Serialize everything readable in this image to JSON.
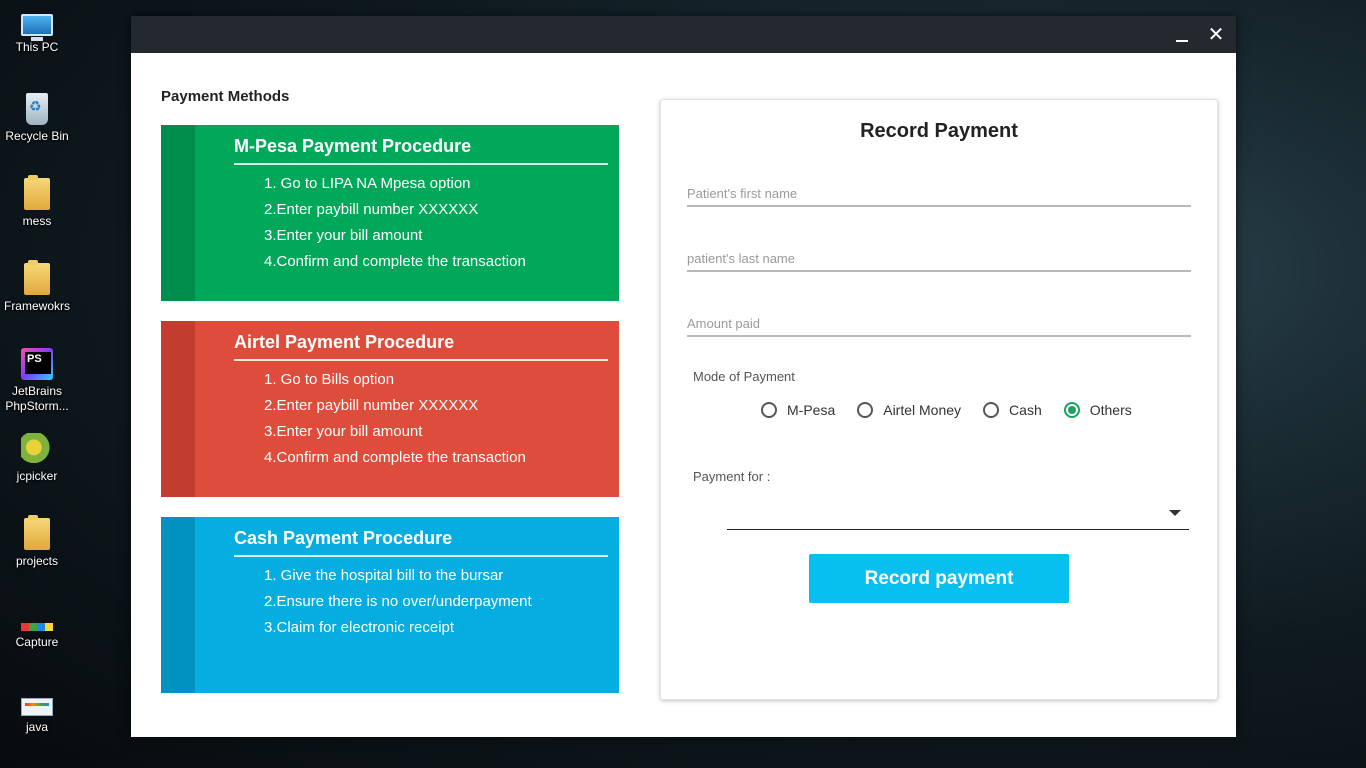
{
  "desktop": {
    "icons": [
      {
        "label": "This PC",
        "icon": "computer-icon"
      },
      {
        "label": "Recycle Bin",
        "icon": "recycle-bin-icon"
      },
      {
        "label": "mess",
        "icon": "folder-icon"
      },
      {
        "label": "Framewokrs",
        "icon": "folder-icon"
      },
      {
        "label": "JetBrains PhpStorm...",
        "icon": "phpstorm-icon"
      },
      {
        "label": "jcpicker",
        "icon": "chameleon-icon"
      },
      {
        "label": "projects",
        "icon": "folder-icon"
      },
      {
        "label": "Capture",
        "icon": "image-icon"
      },
      {
        "label": "java",
        "icon": "file-icon"
      }
    ]
  },
  "window": {
    "minimize_icon": "minimize-icon",
    "close_symbol": "✕"
  },
  "left": {
    "title": "Payment Methods",
    "cards": {
      "mpesa": {
        "title": "M-Pesa Payment Procedure",
        "color": "#02a85a",
        "steps": [
          "1. Go to LIPA NA Mpesa option",
          "2.Enter paybill number XXXXXX",
          "3.Enter your bill amount",
          "4.Confirm and complete the transaction"
        ]
      },
      "airtel": {
        "title": "Airtel Payment Procedure",
        "color": "#de4c3b",
        "steps": [
          "1. Go to Bills option",
          "2.Enter paybill number XXXXXX",
          "3.Enter your bill amount",
          "4.Confirm and complete the transaction"
        ]
      },
      "cash": {
        "title": "Cash Payment Procedure",
        "color": "#06ade0",
        "steps": [
          "1. Give the hospital bill to the bursar",
          "2.Ensure there is no over/underpayment",
          "3.Claim for electronic receipt"
        ]
      }
    }
  },
  "form": {
    "title": "Record Payment",
    "first_name": {
      "placeholder": "Patient's first name",
      "value": ""
    },
    "last_name": {
      "placeholder": "patient's last name",
      "value": ""
    },
    "amount": {
      "placeholder": "Amount paid",
      "value": ""
    },
    "mode_label": "Mode of Payment",
    "mode_options": [
      "M-Pesa",
      "Airtel Money",
      "Cash",
      "Others"
    ],
    "mode_selected": "Others",
    "payment_for_label": "Payment for :",
    "payment_for_value": "",
    "submit_label": "Record payment",
    "accent_color": "#08c0ef",
    "radio_color": "#1aa260"
  }
}
